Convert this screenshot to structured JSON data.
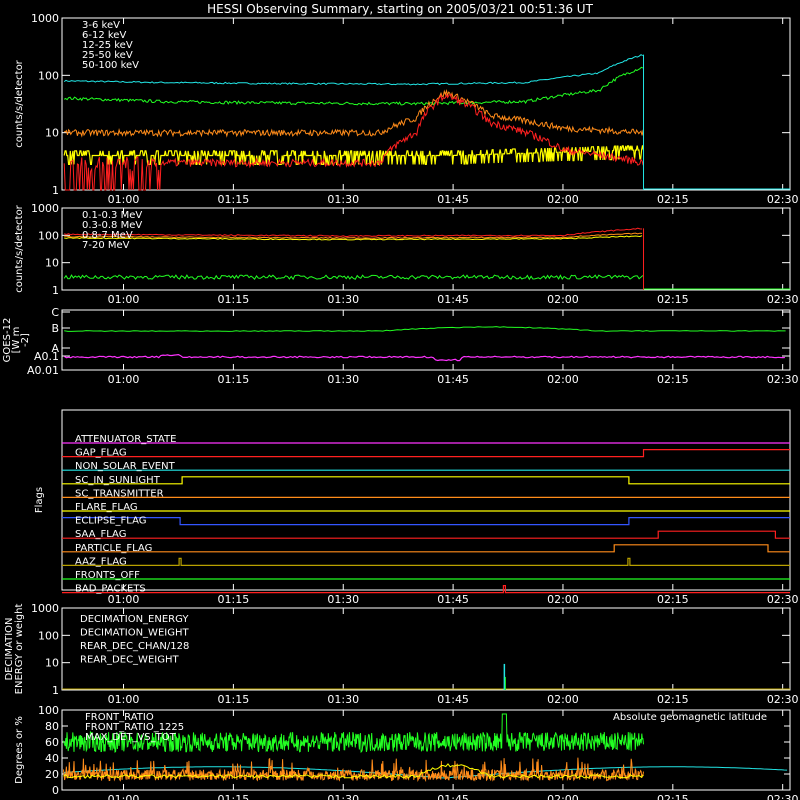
{
  "title": "HESSI Observing Summary, starting on 2005/03/21 00:51:36 UT",
  "colors": {
    "red": "#ff2020",
    "orange": "#ff8c1a",
    "yellow": "#ffff00",
    "green": "#22ff22",
    "cyan": "#22e6e6",
    "magenta": "#ff33ff",
    "blue": "#3355ff",
    "white": "#ffffff",
    "darkyellow": "#b8a000"
  },
  "time_ticks": [
    "01:00",
    "01:15",
    "01:30",
    "01:45",
    "02:00",
    "02:15",
    "02:30"
  ],
  "chart_data": [
    {
      "id": "count-rates-low",
      "type": "line",
      "ylabel": "counts/s/detector",
      "ylim": [
        1,
        1000
      ],
      "yscale": "log",
      "ytick_labels": [
        "1",
        "10",
        "100",
        "1000"
      ],
      "x_range": [
        "00:51:36",
        "02:31"
      ],
      "data_end": "02:11",
      "series": [
        {
          "name": "3-6 keV",
          "color": "#ff2020",
          "x": [
            "00:52",
            "01:05",
            "01:20",
            "01:35",
            "01:40",
            "01:44",
            "01:50",
            "02:00",
            "02:11"
          ],
          "values": [
            3,
            3,
            3,
            3,
            10,
            45,
            15,
            5,
            3
          ]
        },
        {
          "name": "6-12 keV",
          "color": "#ff8c1a",
          "x": [
            "00:52",
            "01:05",
            "01:20",
            "01:35",
            "01:40",
            "01:44",
            "01:50",
            "02:00",
            "02:11"
          ],
          "values": [
            10,
            10,
            10,
            10,
            18,
            50,
            20,
            12,
            10
          ]
        },
        {
          "name": "12-25 keV",
          "color": "#ffff00",
          "x": [
            "00:52",
            "01:20",
            "01:45",
            "02:11"
          ],
          "values": [
            4,
            4,
            4,
            5
          ]
        },
        {
          "name": "25-50 keV",
          "color": "#22ff22",
          "x": [
            "00:52",
            "01:05",
            "01:20",
            "01:40",
            "01:55",
            "02:05",
            "02:11"
          ],
          "values": [
            40,
            35,
            33,
            32,
            35,
            55,
            140
          ]
        },
        {
          "name": "50-100 keV",
          "color": "#22e6e6",
          "x": [
            "00:52",
            "01:05",
            "01:20",
            "01:40",
            "01:55",
            "02:05",
            "02:11"
          ],
          "values": [
            80,
            75,
            72,
            70,
            75,
            110,
            230
          ]
        }
      ]
    },
    {
      "id": "count-rates-high",
      "type": "line",
      "ylabel": "counts/s/detector",
      "ylim": [
        1,
        1000
      ],
      "yscale": "log",
      "ytick_labels": [
        "1",
        "10",
        "100",
        "1000"
      ],
      "series": [
        {
          "name": "0.1-0.3 MeV",
          "color": "#ff2020",
          "x": [
            "00:52",
            "01:30",
            "02:00",
            "02:11"
          ],
          "values": [
            110,
            95,
            100,
            180
          ]
        },
        {
          "name": "0.3-0.8 MeV",
          "color": "#ff8c1a",
          "x": [
            "00:52",
            "01:30",
            "02:00",
            "02:11"
          ],
          "values": [
            90,
            80,
            85,
            120
          ]
        },
        {
          "name": "0.8-7 MeV",
          "color": "#ffff00",
          "x": [
            "00:52",
            "01:30",
            "02:00",
            "02:11"
          ],
          "values": [
            80,
            70,
            75,
            95
          ]
        },
        {
          "name": "7-20 MeV",
          "color": "#22ff22",
          "x": [
            "00:52",
            "01:30",
            "02:00",
            "02:11"
          ],
          "values": [
            3,
            3,
            3,
            3
          ]
        }
      ]
    },
    {
      "id": "goes",
      "type": "line",
      "ylabel": "GOES-12 [W m-2]",
      "ylabel_lines": [
        "GOES-12",
        "[W m",
        "-2]"
      ],
      "ytick_labels": [
        "A0.01",
        "A0.1",
        "A",
        "B",
        "C"
      ],
      "series": [
        {
          "name": "long",
          "color": "#22ff22",
          "x": [
            "00:52",
            "01:20",
            "01:30",
            "01:45",
            "02:00",
            "02:30"
          ],
          "values": [
            "B",
            "B",
            "B",
            "B+",
            "B",
            "B"
          ]
        },
        {
          "name": "short",
          "color": "#ff33ff",
          "x": [
            "00:52",
            "01:43",
            "01:44",
            "01:46",
            "02:30"
          ],
          "values": [
            "A0.1",
            "A0.1",
            "A",
            "A",
            "A0.1"
          ]
        }
      ]
    },
    {
      "id": "flags",
      "type": "table",
      "ylabel": "Flags",
      "flags": [
        {
          "name": "ATTENUATOR_STATE",
          "color": "#ff33ff"
        },
        {
          "name": "GAP_FLAG",
          "color": "#ff2020"
        },
        {
          "name": "NON_SOLAR_EVENT",
          "color": "#22e6e6"
        },
        {
          "name": "SC_IN_SUNLIGHT",
          "color": "#ffff00"
        },
        {
          "name": "SC_TRANSMITTER",
          "color": "#ff8c1a"
        },
        {
          "name": "FLARE_FLAG",
          "color": "#ffff00"
        },
        {
          "name": "ECLIPSE_FLAG",
          "color": "#3355ff"
        },
        {
          "name": "SAA_FLAG",
          "color": "#ff2020"
        },
        {
          "name": "PARTICLE_FLAG",
          "color": "#ff8c1a"
        },
        {
          "name": "AAZ_FLAG",
          "color": "#b8a000"
        },
        {
          "name": "FRONTS_OFF",
          "color": "#22ff22"
        },
        {
          "name": "BAD_PACKETS",
          "color": "#ff2020"
        }
      ]
    },
    {
      "id": "decimation",
      "type": "line",
      "ylabel": "DECIMATION ENERGY or weight",
      "ylabel_lines": [
        "DECIMATION",
        "ENERGY or weight"
      ],
      "ylim": [
        1,
        1000
      ],
      "yscale": "log",
      "ytick_labels": [
        "1",
        "10",
        "100",
        "1000"
      ],
      "series": [
        {
          "name": "DECIMATION_ENERGY",
          "color": "#22ff22"
        },
        {
          "name": "DECIMATION_WEIGHT",
          "color": "#ff8c1a"
        },
        {
          "name": "REAR_DEC_CHAN/128",
          "color": "#22e6e6"
        },
        {
          "name": "REAR_DEC_WEIGHT",
          "color": "#b8a000"
        }
      ]
    },
    {
      "id": "ratios",
      "type": "line",
      "ylabel": "Degrees or %",
      "ylim": [
        0,
        100
      ],
      "ytick_labels": [
        "0",
        "20",
        "40",
        "60",
        "80",
        "100"
      ],
      "annotation": "Absolute geomagnetic latitude",
      "series": [
        {
          "name": "FRONT_RATIO",
          "color": "#ffff00"
        },
        {
          "name": "FRONT_RATIO_1225",
          "color": "#22ff22"
        },
        {
          "name": "MAX_DET_VS_TOT",
          "color": "#ff8c1a"
        },
        {
          "name": "Absolute geomagnetic latitude",
          "color": "#22e6e6"
        }
      ]
    }
  ]
}
